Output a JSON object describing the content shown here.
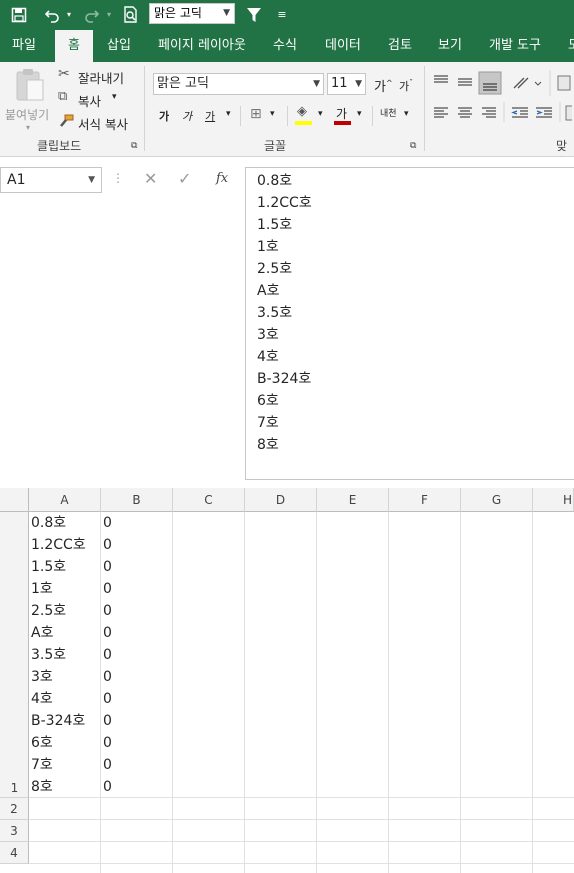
{
  "qat": {
    "font_name": "맑은 고딕"
  },
  "tabs": [
    "파일",
    "홈",
    "삽입",
    "페이지 레이아웃",
    "수식",
    "데이터",
    "검토",
    "보기",
    "개발 도구",
    "도"
  ],
  "ribbon": {
    "clipboard": {
      "paste": "붙여넣기",
      "cut": "잘라내기",
      "copy": "복사",
      "format_painter": "서식 복사",
      "label": "클립보드"
    },
    "font": {
      "font_name": "맑은 고딕",
      "font_size": "11",
      "grow": "가",
      "shrink": "가",
      "bold": "가",
      "italic": "가",
      "underline": "가",
      "font_color": "가",
      "phonetic": "내천",
      "label": "글꼴"
    },
    "alignment": {
      "label": "맞춤"
    }
  },
  "formula_bar": {
    "name_box": "A1",
    "fx": "fx",
    "lines": [
      "0.8호",
      "1.2CC호",
      "1.5호",
      "1호",
      "2.5호",
      "A호",
      "3.5호",
      "3호",
      "4호",
      "B-324호",
      "6호",
      "7호",
      "8호"
    ]
  },
  "grid": {
    "columns": [
      "A",
      "B",
      "C",
      "D",
      "E",
      "F",
      "G",
      "H"
    ],
    "rows": [
      "1",
      "2",
      "3",
      "4"
    ],
    "a1_lines": [
      "0.8호",
      "1.2CC호",
      "1.5호",
      "1호",
      "2.5호",
      "A호",
      "3.5호",
      "3호",
      "4호",
      "B-324호",
      "6호",
      "7호",
      "8호"
    ],
    "b1_lines": [
      "0",
      "0",
      "0",
      "0",
      "0",
      "0",
      "0",
      "0",
      "0",
      "0",
      "0",
      "0",
      "0"
    ]
  },
  "colors": {
    "excel_green": "#217346",
    "ribbon_bg": "#f3f3f3",
    "highlight_yellow": "#ffff00",
    "font_red": "#c00000"
  }
}
